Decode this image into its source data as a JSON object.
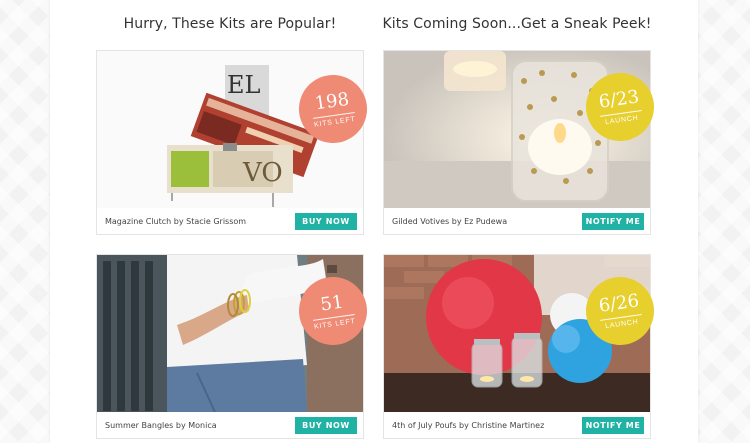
{
  "headings": {
    "popular": "Hurry, These Kits are Popular!",
    "coming_soon": "Kits Coming Soon...Get a Sneak Peek!"
  },
  "colors": {
    "button_teal": "#20b2a4",
    "badge_salmon": "#ef8a74",
    "badge_yellow": "#e7cf2e"
  },
  "cards": [
    {
      "caption": "Magazine Clutch by Stacie Grissom",
      "button": "BUY NOW",
      "badge_number": "198",
      "badge_text": "KITS LEFT"
    },
    {
      "caption": "Gilded Votives by Ez Pudewa",
      "button": "NOTIFY ME",
      "badge_number": "6/23",
      "badge_text": "LAUNCH"
    },
    {
      "caption": "Summer Bangles by Monica",
      "button": "BUY NOW",
      "badge_number": "51",
      "badge_text": "KITS LEFT"
    },
    {
      "caption": "4th of July Poufs by Christine Martinez",
      "button": "NOTIFY ME",
      "badge_number": "6/26",
      "badge_text": "LAUNCH"
    }
  ],
  "images": {
    "clutch_magazine_letters": "EL",
    "clutch_magazine_letters_2": "VO"
  }
}
